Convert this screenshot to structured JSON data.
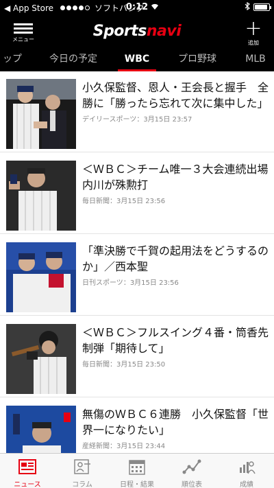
{
  "status_bar": {
    "back_label": "◀ App Store",
    "signal_dots": 4,
    "carrier": "ソフトバンク",
    "time": "0:12",
    "battery_fill": 0.92
  },
  "header": {
    "logo_part1": "Sports",
    "logo_part2": "navi",
    "menu_label": "メニュー",
    "add_label": "追加",
    "brand_color": "#e60012"
  },
  "tabs": [
    {
      "label": "ップ",
      "active": false
    },
    {
      "label": "今日の予定",
      "active": false
    },
    {
      "label": "WBC",
      "active": true
    },
    {
      "label": "プロ野球",
      "active": false
    },
    {
      "label": "MLB",
      "active": false
    }
  ],
  "articles": [
    {
      "title": "小久保監督、恩人・王会長と握手　全勝に「勝ったら忘れて次に集中した」",
      "source": "デイリースポーツ",
      "date": "3月15日 23:57"
    },
    {
      "title": "＜ＷＢＣ＞チーム唯一３大会連続出場　内川が殊勲打",
      "source": "毎日新聞",
      "date": "3月15日 23:56"
    },
    {
      "title": "「準決勝で千賀の起用法をどうするのか」／西本聖",
      "source": "日刊スポーツ",
      "date": "3月15日 23:56"
    },
    {
      "title": "＜ＷＢＣ＞フルスイング４番・筒香先制弾「期待して」",
      "source": "毎日新聞",
      "date": "3月15日 23:50"
    },
    {
      "title": "無傷のＷＢＣ６連勝　小久保監督「世界一になりたい」",
      "source": "産経新聞",
      "date": "3月15日 23:44"
    }
  ],
  "tabbar": [
    {
      "label": "ニュース",
      "icon": "news-icon",
      "active": true
    },
    {
      "label": "コラム",
      "icon": "column-icon",
      "active": false
    },
    {
      "label": "日程・結果",
      "icon": "calendar-icon",
      "active": false
    },
    {
      "label": "順位表",
      "icon": "ranking-chart-icon",
      "active": false
    },
    {
      "label": "成績",
      "icon": "stats-icon",
      "active": false
    }
  ]
}
